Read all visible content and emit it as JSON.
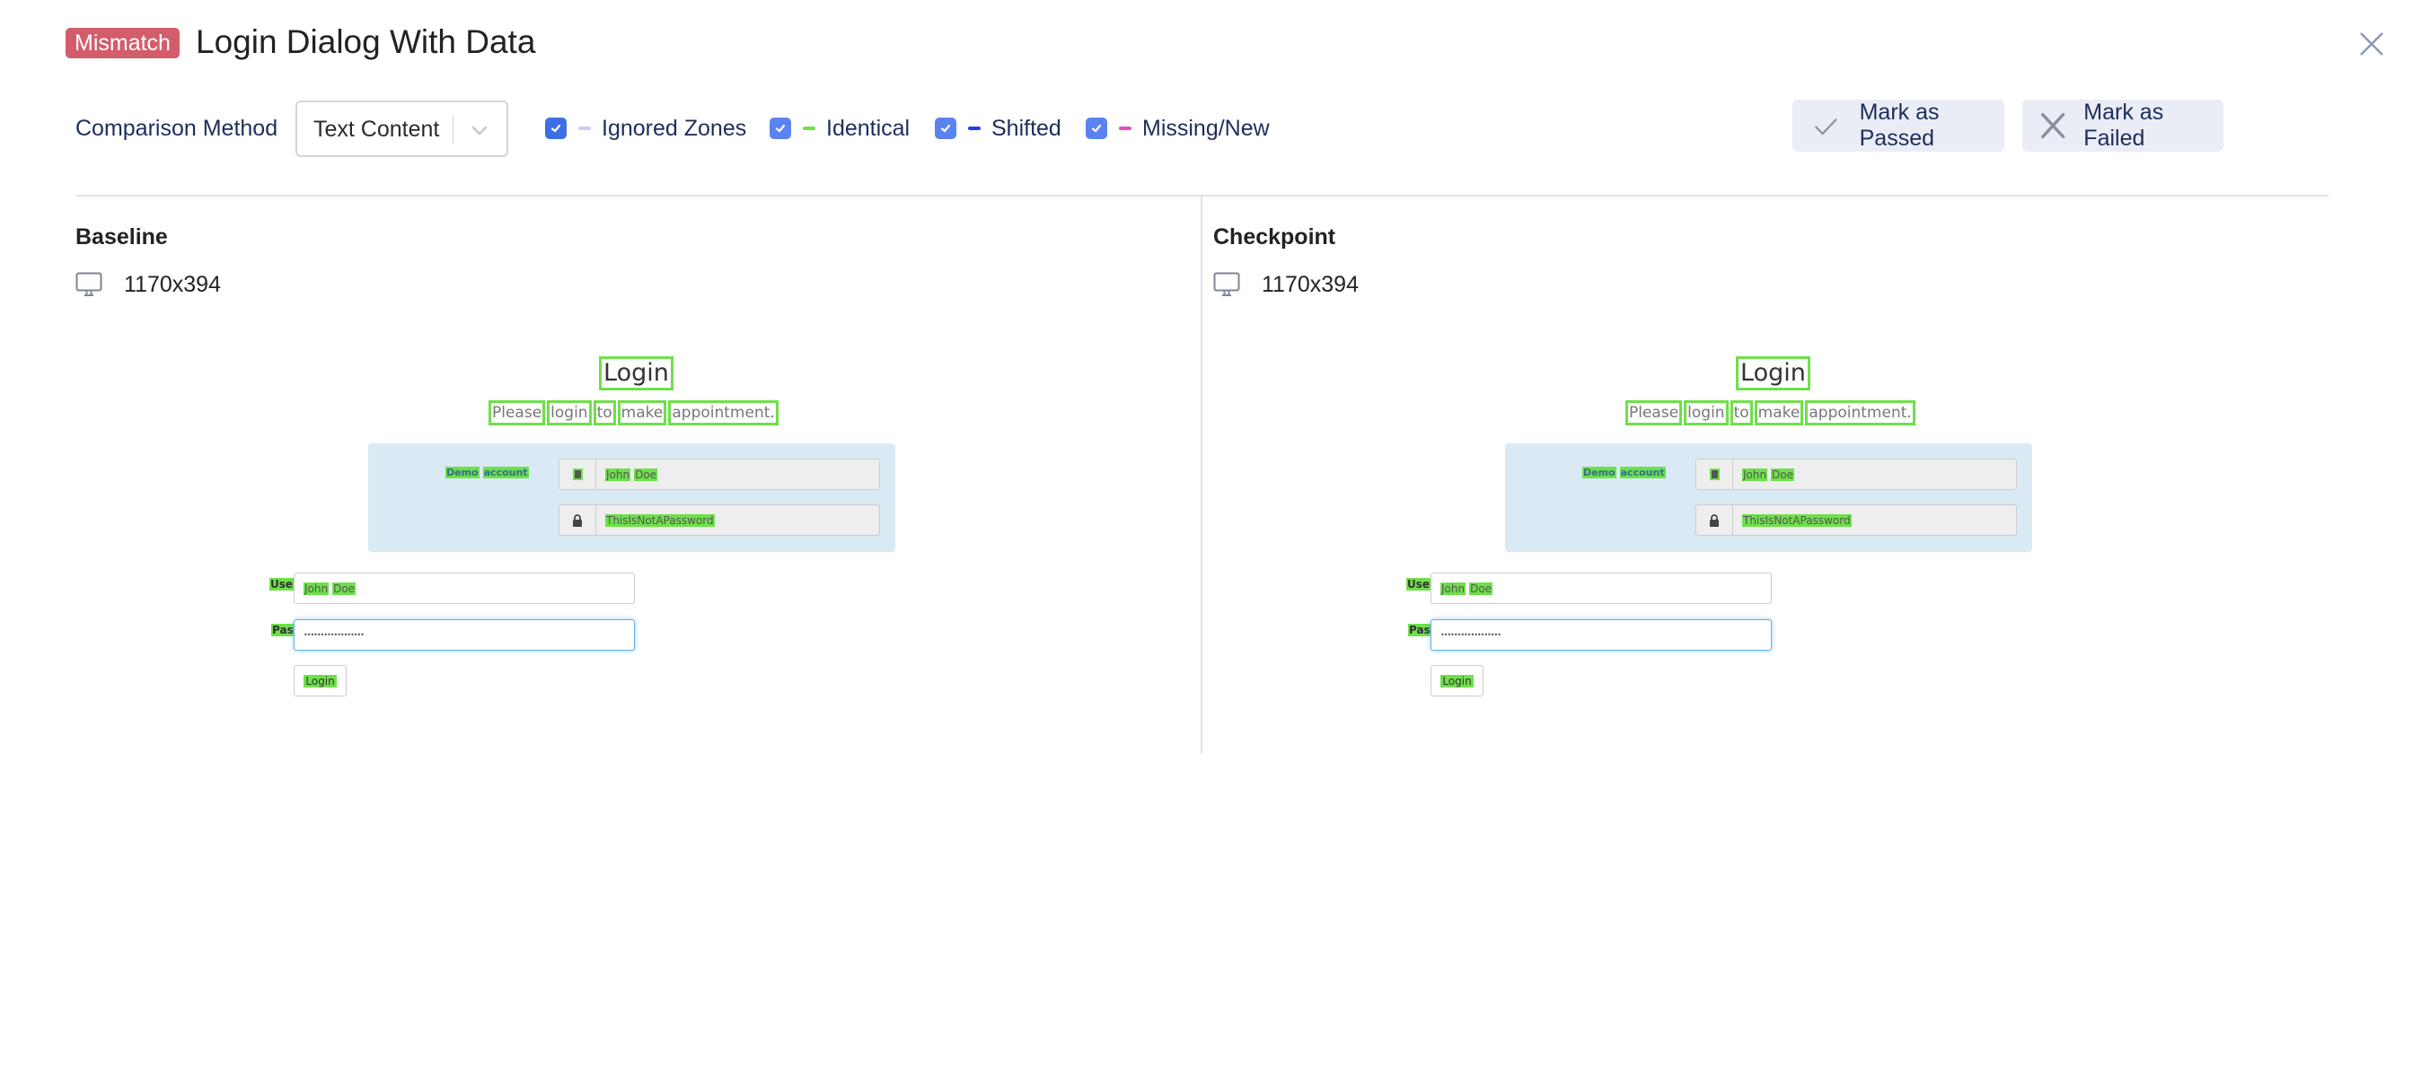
{
  "header": {
    "status_badge": "Mismatch",
    "title": "Login Dialog With Data",
    "close_icon": "close-icon"
  },
  "toolbar": {
    "comparison_method_label": "Comparison Method",
    "comparison_method_value": "Text Content",
    "legend": [
      {
        "label": "Ignored Zones",
        "checked": true,
        "color": "#d8c8f5"
      },
      {
        "label": "Identical",
        "checked": true,
        "color": "#6ee04a"
      },
      {
        "label": "Shifted",
        "checked": true,
        "color": "#1f3ef0"
      },
      {
        "label": "Missing/New",
        "checked": true,
        "color": "#e84bc4"
      }
    ],
    "mark_passed_label": "Mark as Passed",
    "mark_failed_label": "Mark as Failed"
  },
  "panels": [
    {
      "title": "Baseline",
      "dimensions": "1170x394",
      "device_icon": "monitor-icon"
    },
    {
      "title": "Checkpoint",
      "dimensions": "1170x394",
      "device_icon": "monitor-icon"
    }
  ],
  "screenshot": {
    "heading": "Login",
    "subtitle_words": [
      "Please",
      "login",
      "to",
      "make",
      "appointment."
    ],
    "demo_account_label": [
      "Demo",
      "account"
    ],
    "demo_username_words": [
      "John",
      "Doe"
    ],
    "demo_password": "ThisIsNotAPassword",
    "username_label": "Username",
    "username_value_words": [
      "John",
      "Doe"
    ],
    "password_label": "Password",
    "password_value": "••••••••••••••••••",
    "login_button": "Login",
    "highlight_color": "#6ee04a"
  }
}
